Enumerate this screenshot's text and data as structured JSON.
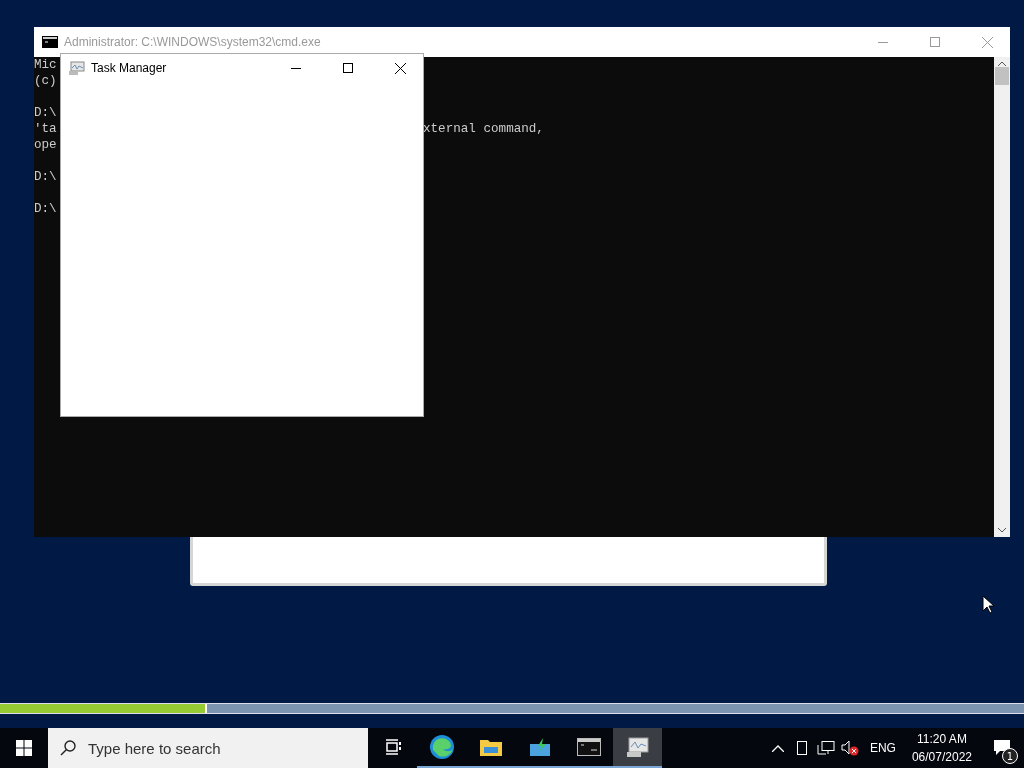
{
  "console_window": {
    "title": "Administrator: C:\\WINDOWS\\system32\\cmd.exe",
    "blocks": [
      {
        "lines": [
          {
            "left": "Mic"
          },
          {
            "left": "(c)"
          }
        ]
      },
      {
        "lines": [
          {
            "left": "D:\\"
          },
          {
            "left": "'ta",
            "right": "xternal command,"
          },
          {
            "left": "ope"
          }
        ]
      },
      {
        "lines": [
          {
            "left": "D:\\"
          }
        ]
      },
      {
        "lines": [
          {
            "left": "D:\\"
          }
        ]
      }
    ]
  },
  "task_manager_window": {
    "title": "Task Manager"
  },
  "progress": {
    "level": 0.2
  },
  "taskbar": {
    "search": {
      "placeholder": "Type here to search"
    },
    "apps": [
      {
        "kind": "taskview",
        "selected": false,
        "running": false
      },
      {
        "kind": "edge",
        "selected": false,
        "running": true
      },
      {
        "kind": "explorer",
        "selected": false,
        "running": true
      },
      {
        "kind": "install",
        "selected": false,
        "running": true
      },
      {
        "kind": "cmd",
        "selected": false,
        "running": true
      },
      {
        "kind": "taskmgr",
        "selected": true,
        "running": true
      }
    ],
    "language": "ENG",
    "time": "11:20 AM",
    "date": "06/07/2022",
    "notifications": "1"
  }
}
